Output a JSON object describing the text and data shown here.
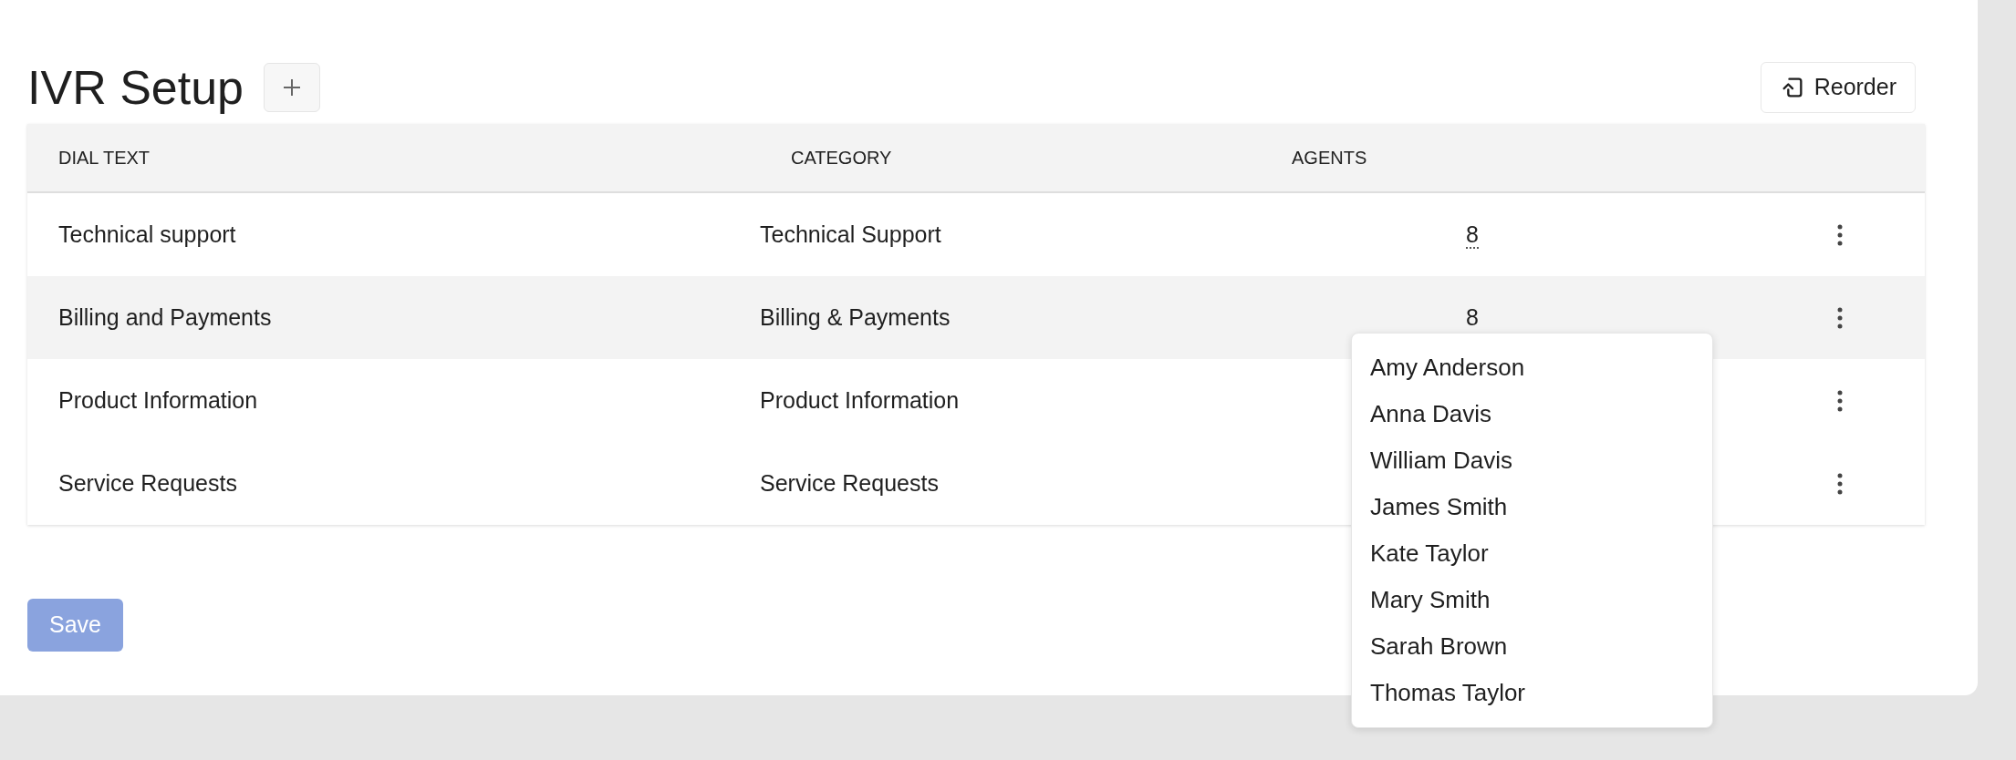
{
  "header": {
    "title": "IVR Setup",
    "reorder_label": "Reorder"
  },
  "table": {
    "columns": [
      "DIAL TEXT",
      "CATEGORY",
      "AGENTS"
    ],
    "rows": [
      {
        "dial_text": "Technical support",
        "category": "Technical Support",
        "agents": "8",
        "agents_active": true,
        "hovered": false
      },
      {
        "dial_text": "Billing and Payments",
        "category": "Billing & Payments",
        "agents": "8",
        "agents_active": false,
        "hovered": true
      },
      {
        "dial_text": "Product Information",
        "category": "Product Information",
        "hovered": false
      },
      {
        "dial_text": "Service Requests",
        "category": "Service Requests",
        "hovered": false
      }
    ]
  },
  "agents_popup": {
    "items": [
      "Amy Anderson",
      "Anna Davis",
      "William Davis",
      "James Smith",
      "Kate Taylor",
      "Mary Smith",
      "Sarah Brown",
      "Thomas Taylor"
    ]
  },
  "save_button": {
    "label": "Save",
    "disabled": true
  }
}
